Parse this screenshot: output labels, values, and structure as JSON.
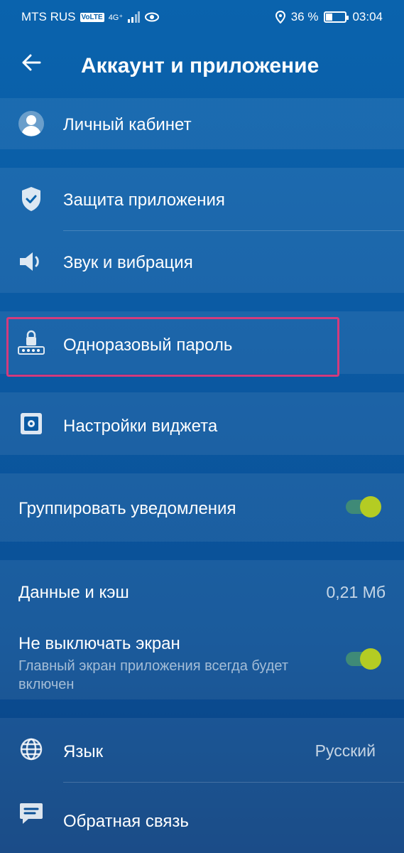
{
  "status_bar": {
    "carrier": "MTS RUS",
    "volte": "VoLTE",
    "network": "4G⁺",
    "battery_percent": "36 %",
    "time": "03:04",
    "battery_level": 0.36
  },
  "header": {
    "title": "Аккаунт и приложение"
  },
  "menu": {
    "personal_cabinet": "Личный кабинет",
    "app_protection": "Защита приложения",
    "sound_vibration": "Звук и вибрация",
    "one_time_password": "Одноразовый пароль",
    "widget_settings": "Настройки виджета",
    "group_notifications": "Группировать уведомления",
    "group_notifications_on": true,
    "data_cache": "Данные и кэш",
    "data_cache_value": "0,21 Мб",
    "keep_screen_on": "Не выключать экран",
    "keep_screen_on_sub": "Главный экран приложения всегда будет включен",
    "keep_screen_on_on": true,
    "language": "Язык",
    "language_value": "Русский",
    "feedback": "Обратная связь"
  },
  "colors": {
    "toggle_knob": "#b4cc23",
    "toggle_track": "#3f8a77",
    "highlight": "#d33b7d"
  }
}
